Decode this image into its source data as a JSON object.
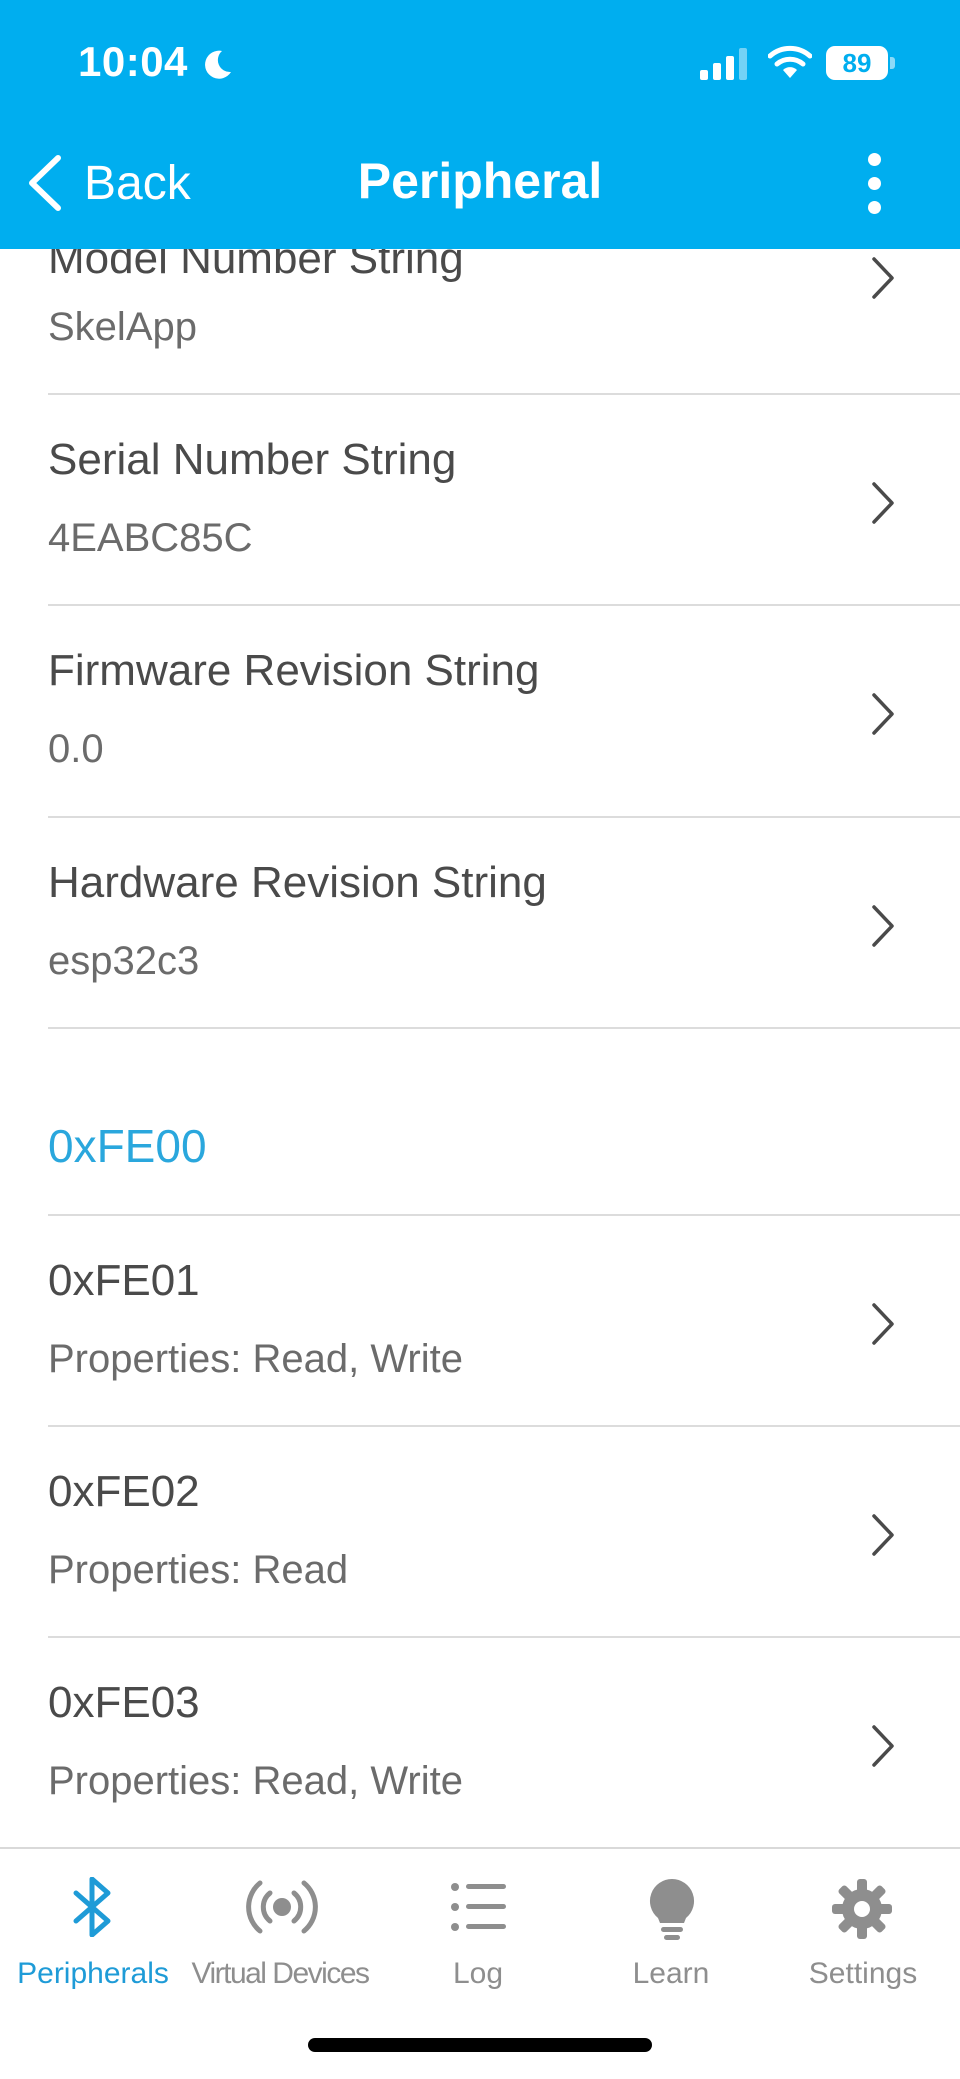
{
  "status_bar": {
    "time": "10:04",
    "battery": "89"
  },
  "nav": {
    "back_label": "Back",
    "title": "Peripheral"
  },
  "rows": [
    {
      "title": "Model Number String",
      "value": "SkelApp"
    },
    {
      "title": "Serial Number String",
      "value": "4EABC85C"
    },
    {
      "title": "Firmware Revision String",
      "value": "0.0"
    },
    {
      "title": "Hardware Revision String",
      "value": "esp32c3"
    }
  ],
  "section": {
    "title": "0xFE00",
    "characteristics": [
      {
        "title": "0xFE01",
        "properties": "Properties: Read, Write"
      },
      {
        "title": "0xFE02",
        "properties": "Properties: Read"
      },
      {
        "title": "0xFE03",
        "properties": "Properties: Read, Write"
      }
    ]
  },
  "tabs": [
    {
      "label": "Peripherals",
      "icon": "bluetooth-icon",
      "active": true
    },
    {
      "label": "Virtual Devices",
      "icon": "broadcast-icon",
      "active": false
    },
    {
      "label": "Log",
      "icon": "list-icon",
      "active": false
    },
    {
      "label": "Learn",
      "icon": "lightbulb-icon",
      "active": false
    },
    {
      "label": "Settings",
      "icon": "gear-icon",
      "active": false
    }
  ],
  "colors": {
    "header": "#00AEEF",
    "accent": "#1E9BD7",
    "section": "#2AA7DD"
  }
}
